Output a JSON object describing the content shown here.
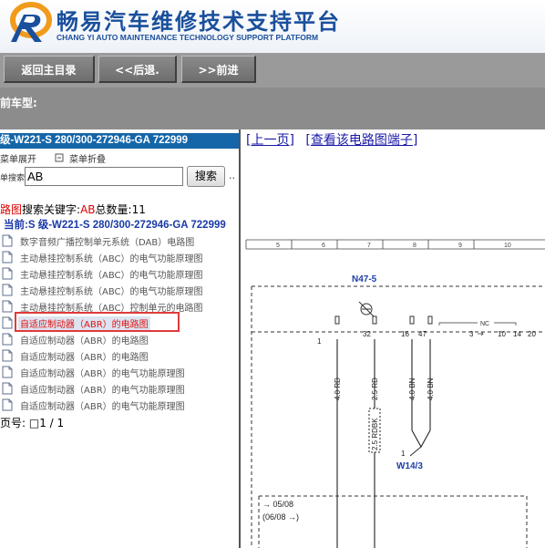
{
  "header": {
    "title_cn": "畅易汽车维修技术支持平台",
    "title_en": "CHANG YI AUTO MAINTENANCE TECHNOLOGY SUPPORT PLATFORM",
    "logo_icon": "cy-logo-icon",
    "brand_color": "#1a4f9c"
  },
  "nav": {
    "home_label": "返回主目录",
    "back_label": "<<后退.",
    "forward_label": ">>前进"
  },
  "car": {
    "label": "前车型:"
  },
  "left": {
    "model": "级-W221-S 280/300-272946-GA 722999",
    "expand_label": "菜单展开",
    "collapse_label": "菜单折叠",
    "search_label": "单搜索",
    "search_value": "AB",
    "search_button": "搜索",
    "more": "..",
    "result_prefix": "路图",
    "result_mid": "搜索关键字:",
    "result_keyword": "AB",
    "result_count_label": "总数量:",
    "result_count": "11",
    "current": "当前:S 级-W221-S 280/300-272946-GA 722999",
    "items": [
      "数字音频广播控制单元系统（DAB）电路图",
      "主动悬挂控制系统（ABC）的电气功能原理图",
      "主动悬挂控制系统（ABC）的电气功能原理图",
      "主动悬挂控制系统（ABC）的电气功能原理图",
      "主动悬挂控制系统（ABC）控制单元的电路图",
      "自适应制动器（ABR）的电路图",
      "自适应制动器（ABR）的电路图",
      "自适应制动器（ABR）的电路图",
      "自适应制动器（ABR）的电气功能原理图",
      "自适应制动器（ABR）的电气功能原理图",
      "自适应制动器（ABR）的电气功能原理图"
    ],
    "selected_index": 5,
    "pager": "页号: □1 / 1"
  },
  "right": {
    "prev_page": "[上一页]",
    "view_terminals": "[查看该电路图端子]",
    "ruler": [
      "5",
      "6",
      "7",
      "8",
      "9",
      "10"
    ],
    "component": "N47-5",
    "pins": [
      "1",
      "32",
      "16",
      "47",
      "3",
      "10",
      "14",
      "20"
    ],
    "nc": "NC",
    "wires": [
      "4.0 RD",
      "2.5 RD",
      "4.0 BN",
      "4.0 BN"
    ],
    "wire_box": "2.5 RDBK",
    "connector": "W14/3",
    "connector_pin": "1",
    "note1": "→ 05/08",
    "note2": "(06/08 →)"
  }
}
